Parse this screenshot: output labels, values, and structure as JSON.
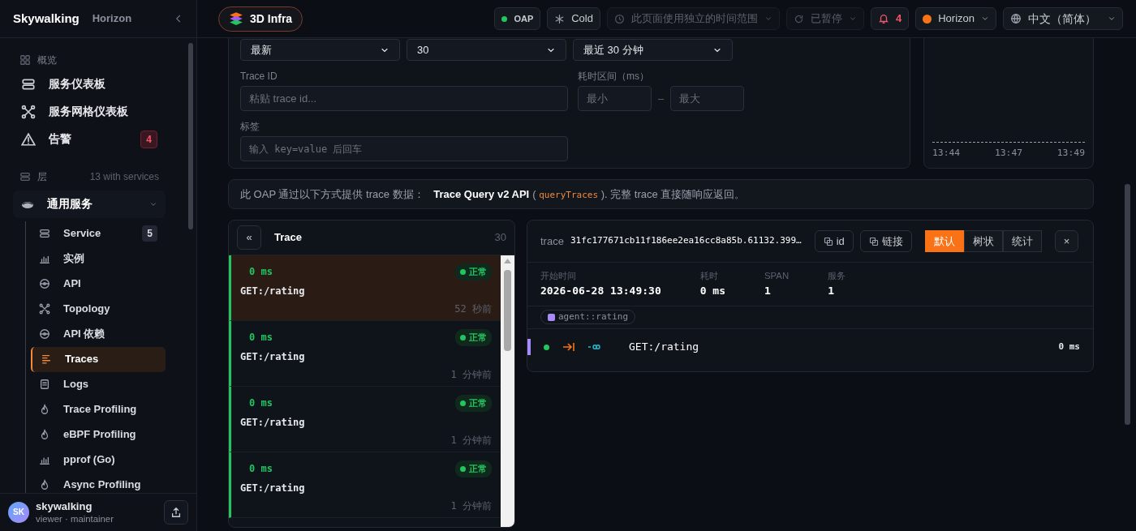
{
  "sidebar": {
    "brand": "Skywalking",
    "product": "Horizon",
    "sections": [
      {
        "label": "概览",
        "items": [
          {
            "label": "服务仪表板"
          },
          {
            "label": "服务网格仪表板"
          },
          {
            "label": "告警",
            "badge": "4"
          }
        ]
      }
    ],
    "layers": {
      "label": "层",
      "note": "13 with services",
      "groups": [
        {
          "label": "通用服务",
          "expanded": true,
          "children": [
            {
              "label": "Service",
              "badge": "5",
              "selected": false
            },
            {
              "label": "实例",
              "selected": false
            },
            {
              "label": "API",
              "selected": false
            },
            {
              "label": "Topology",
              "selected": false
            },
            {
              "label": "API 依赖",
              "selected": false
            },
            {
              "label": "Traces",
              "selected": true
            },
            {
              "label": "Logs",
              "selected": false
            },
            {
              "label": "Trace Profiling",
              "selected": false
            },
            {
              "label": "eBPF Profiling",
              "selected": false
            },
            {
              "label": "pprof (Go)",
              "selected": false
            },
            {
              "label": "Async Profiling",
              "selected": false
            }
          ]
        }
      ]
    },
    "user": {
      "initials": "SK",
      "name": "skywalking",
      "roles": "viewer · maintainer"
    }
  },
  "topbar": {
    "workspace": "3D Infra",
    "oap": {
      "label": "OAP",
      "online": true
    },
    "cold": "Cold",
    "time_range": {
      "label": "此页面使用独立的时间范围",
      "disabled": true
    },
    "refresh": {
      "label": "已暂停",
      "disabled": true
    },
    "alerts": "4",
    "theme": {
      "label": "Horizon",
      "color": "#f97316"
    },
    "language": "中文（简体）"
  },
  "filters": {
    "selects": [
      {
        "value": "最新"
      },
      {
        "value": "30"
      },
      {
        "value": "最近 30 分钟"
      }
    ],
    "trace_id": {
      "label": "Trace ID",
      "placeholder": "粘贴 trace id..."
    },
    "duration": {
      "label": "耗时区间（ms）",
      "min_placeholder": "最小",
      "separator": "–",
      "max_placeholder": "最大"
    },
    "tags": {
      "label": "标签",
      "placeholder": "输入 key=value 后回车"
    }
  },
  "chart": {
    "time_labels": [
      "13:44",
      "13:47",
      "13:49"
    ]
  },
  "info": {
    "prefix": "此 OAP 通过以下方式提供 trace 数据：",
    "api": "Trace Query v2 API",
    "open": "(",
    "code": "queryTraces",
    "close": "). 完整 trace 直接随响应返回。"
  },
  "trace_list": {
    "collapse": "«",
    "title": "Trace",
    "count": "30",
    "rows": [
      {
        "duration": "0 ms",
        "status": "正常",
        "endpoint": "GET:/rating",
        "time": "52 秒前",
        "selected": true
      },
      {
        "duration": "0 ms",
        "status": "正常",
        "endpoint": "GET:/rating",
        "time": "1 分钟前",
        "selected": false
      },
      {
        "duration": "0 ms",
        "status": "正常",
        "endpoint": "GET:/rating",
        "time": "1 分钟前",
        "selected": false
      },
      {
        "duration": "0 ms",
        "status": "正常",
        "endpoint": "GET:/rating",
        "time": "1 分钟前",
        "selected": false
      }
    ]
  },
  "detail": {
    "label": "trace",
    "trace_id": "31fc177671cb11f186ee2ea16cc8a85b.61132.399…",
    "copy_buttons": [
      "id",
      "链接"
    ],
    "views": [
      {
        "label": "默认",
        "selected": true
      },
      {
        "label": "树状",
        "selected": false
      },
      {
        "label": "统计",
        "selected": false
      }
    ],
    "close": "×",
    "stats": [
      {
        "label": "开始时间",
        "value": "2026-06-28 13:49:30"
      },
      {
        "label": "耗时",
        "value": "0 ms"
      },
      {
        "label": "SPAN",
        "value": "1"
      },
      {
        "label": "服务",
        "value": "1"
      }
    ],
    "services": [
      {
        "name": "agent::rating",
        "color": "#a78bfa"
      }
    ],
    "spans": [
      {
        "endpoint": "GET:/rating",
        "duration": "0 ms",
        "color": "#a78bfa"
      }
    ]
  }
}
